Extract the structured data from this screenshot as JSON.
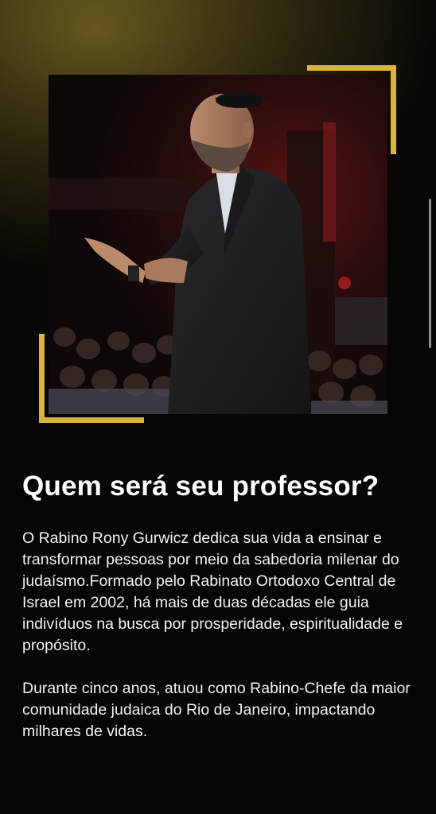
{
  "hero": {
    "image_alt": "Rabino Rony Gurwicz",
    "accent_color": "#d9b43e"
  },
  "section": {
    "title": "Quem será seu professor?",
    "paragraphs": [
      "O Rabino Rony Gurwicz dedica sua vida a ensinar e transformar pessoas por meio da sabedoria milenar do judaísmo.Formado pelo Rabinato Ortodoxo Central de Israel em 2002, há mais de duas décadas ele guia indivíduos na busca por prosperidade, espiritualidade e propósito.",
      "Durante cinco anos, atuou como Rabino-Chefe da maior comunidade judaica do Rio de Janeiro, impactando milhares de vidas."
    ]
  }
}
